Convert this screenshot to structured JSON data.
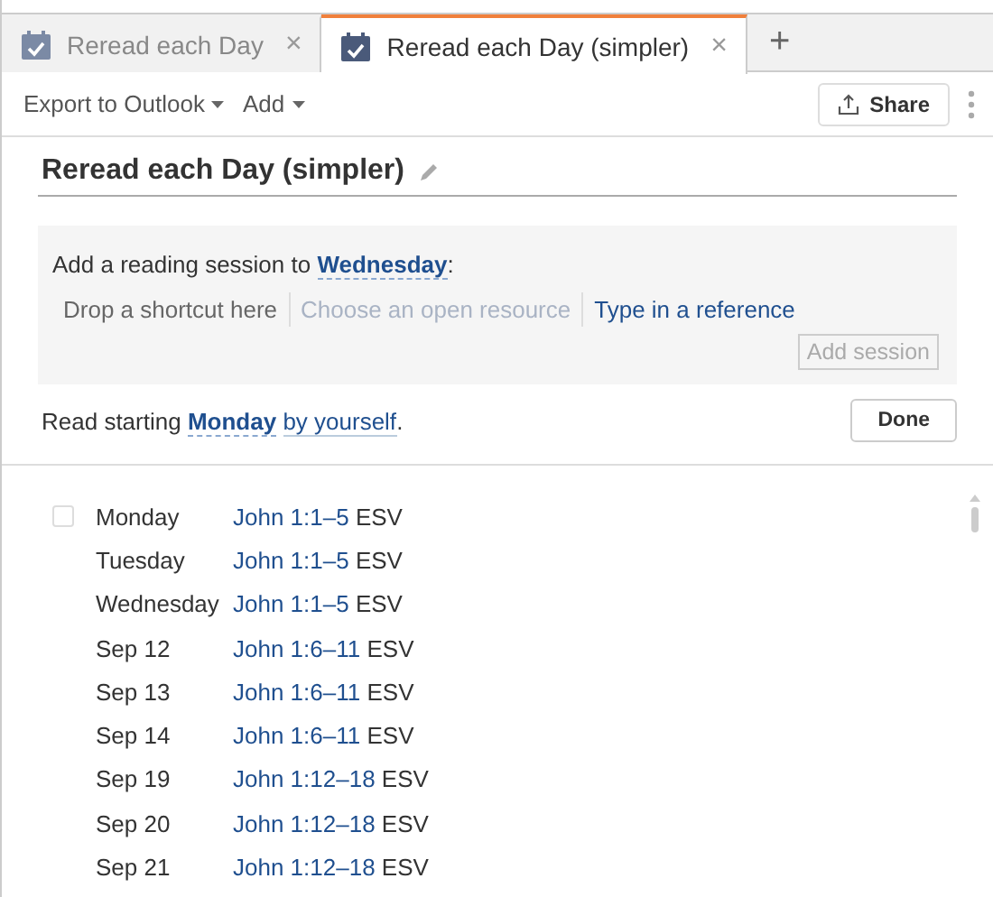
{
  "tabs": [
    {
      "label": "Reread each Day",
      "selected": false,
      "close": "×"
    },
    {
      "label": "Reread each Day (simpler)",
      "selected": true,
      "close": "×"
    }
  ],
  "new_tab": "+",
  "toolbar": {
    "menus": [
      "Export to Outlook",
      "Add"
    ],
    "share": "Share"
  },
  "plan_title": "Reread each Day (simpler)",
  "add_session": {
    "prefix": "Add a reading session to ",
    "day": "Wednesday",
    "suffix": ":",
    "sources": [
      {
        "label": "Drop a shortcut here",
        "kind": "hint"
      },
      {
        "label": "Choose an open resource",
        "kind": "disabled"
      },
      {
        "label": "Type in a reference",
        "kind": "link"
      }
    ],
    "button": "Add session"
  },
  "reading": {
    "prefix": "Read starting ",
    "day": "Monday",
    "mode": "by yourself",
    "suffix": ".",
    "done": "Done"
  },
  "schedule": [
    {
      "day": "Monday",
      "reference": "John 1:1–5",
      "version": "ESV",
      "checked": false
    },
    {
      "day": "Tuesday",
      "reference": "John 1:1–5",
      "version": "ESV"
    },
    {
      "day": "Wednesday",
      "reference": "John 1:1–5",
      "version": "ESV"
    },
    {
      "day": "Sep 12",
      "reference": "John 1:6–11",
      "version": "ESV"
    },
    {
      "day": "Sep 13",
      "reference": "John 1:6–11",
      "version": "ESV"
    },
    {
      "day": "Sep 14",
      "reference": "John 1:6–11",
      "version": "ESV"
    },
    {
      "day": "Sep 19",
      "reference": "John 1:12–18",
      "version": "ESV"
    },
    {
      "day": "Sep 20",
      "reference": "John 1:12–18",
      "version": "ESV"
    },
    {
      "day": "Sep 21",
      "reference": "John 1:12–18",
      "version": "ESV"
    }
  ]
}
